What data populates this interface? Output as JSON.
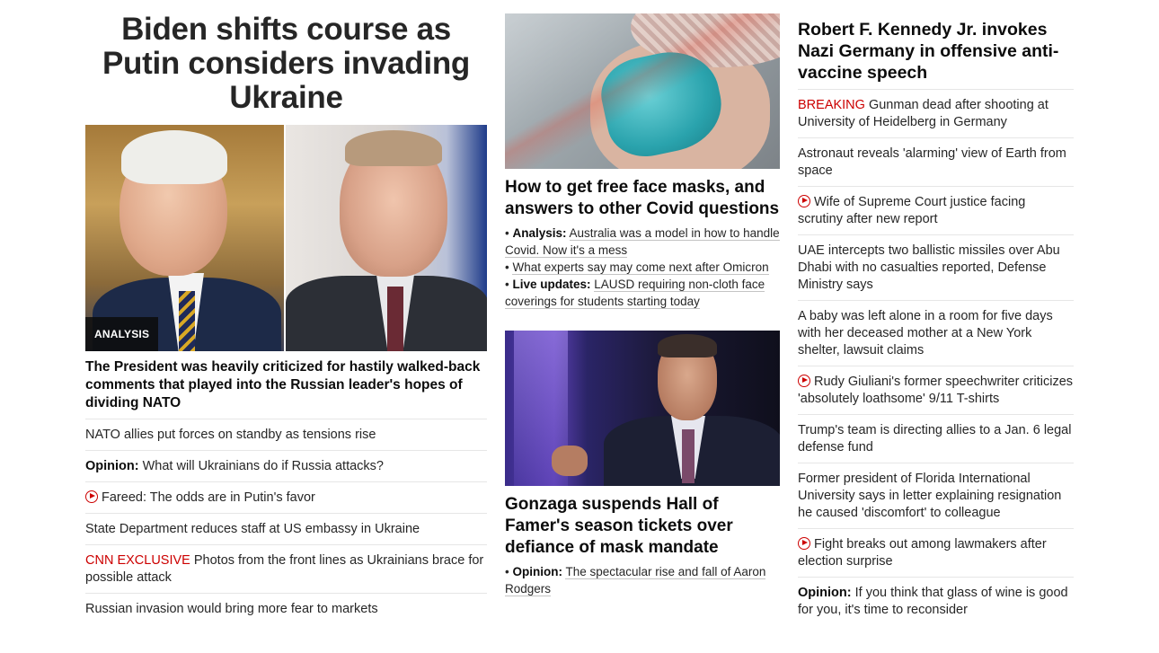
{
  "left": {
    "headline": "Biden shifts course as Putin considers invading Ukraine",
    "badge": "ANALYSIS",
    "subheadline": "The President was heavily criticized for hastily walked-back comments that played into the Russian leader's hopes of dividing NATO",
    "items": [
      {
        "text": "NATO allies put forces on standby as tensions rise"
      },
      {
        "prefix": "Opinion:",
        "text": " What will Ukrainians do if Russia attacks?"
      },
      {
        "text": "Fareed: The odds are in Putin's favor"
      },
      {
        "text": "State Department reduces staff at US embassy in Ukraine"
      },
      {
        "label": "CNN EXCLUSIVE",
        "text": " Photos from the front lines as Ukrainians brace for possible attack"
      },
      {
        "text": "Russian invasion would bring more fear to markets"
      }
    ]
  },
  "middle": {
    "story1": {
      "headline": "How to get free face masks, and answers to other Covid questions",
      "bullets": [
        {
          "prefix": "Analysis:",
          "text": "Australia was a model in how to handle Covid. Now it's a mess"
        },
        {
          "text": "What experts say may come next after Omicron"
        },
        {
          "prefix": "Live updates:",
          "text": "LAUSD requiring non-cloth face coverings for students starting today"
        }
      ]
    },
    "story2": {
      "headline": "Gonzaga suspends Hall of Famer's season tickets over defiance of mask mandate",
      "bullets": [
        {
          "prefix": "Opinion:",
          "text": "The spectacular rise and fall of Aaron Rodgers"
        }
      ]
    }
  },
  "right": {
    "headline": "Robert F. Kennedy Jr. invokes Nazi Germany in offensive anti-vaccine speech",
    "items": [
      {
        "label": "BREAKING",
        "text": " Gunman dead after shooting at University of Heidelberg in Germany"
      },
      {
        "text": "Astronaut reveals 'alarming' view of Earth from space"
      },
      {
        "text": "Wife of Supreme Court justice facing scrutiny after new report"
      },
      {
        "text": "UAE intercepts two ballistic missiles over Abu Dhabi with no casualties reported, Defense Ministry says"
      },
      {
        "text": "A baby was left alone in a room for five days with her deceased mother at a New York shelter, lawsuit claims"
      },
      {
        "text": "Rudy Giuliani's former speechwriter criticizes 'absolutely loathsome' 9/11 T-shirts"
      },
      {
        "text": "Trump's team is directing allies to a Jan. 6 legal defense fund"
      },
      {
        "text": "Former president of Florida International University says in letter explaining resignation he caused 'discomfort' to colleague"
      },
      {
        "text": "Fight breaks out among lawmakers after election surprise"
      },
      {
        "prefix": "Opinion:",
        "text": " If you think that glass of wine is good for you, it's time to reconsider"
      }
    ]
  },
  "colors": {
    "accent_red": "#cc0000",
    "text": "#0c0c0c",
    "divider": "#e6e6e6"
  },
  "icons": {
    "video": "play-circle-icon"
  }
}
